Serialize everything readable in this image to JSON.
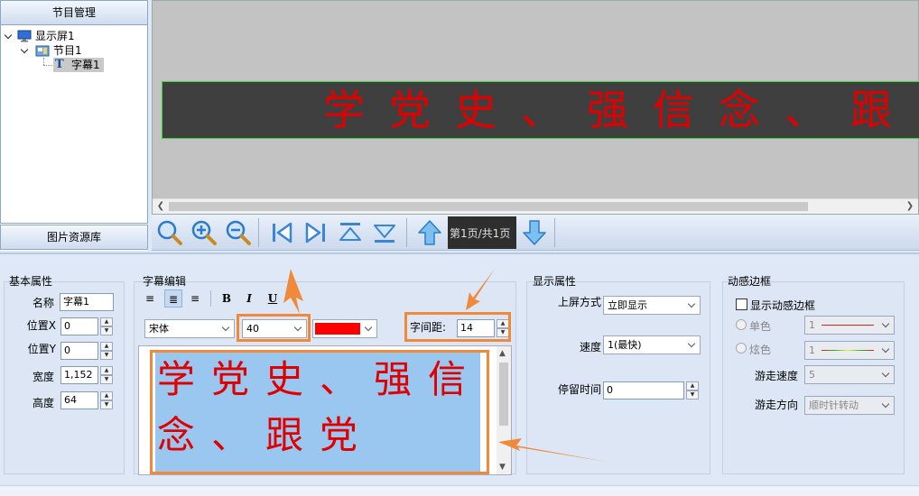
{
  "left_panel": {
    "header": "节目管理",
    "footer": "图片资源库",
    "tree": [
      {
        "label": "显示屏1"
      },
      {
        "label": "节目1"
      },
      {
        "label": "字幕1"
      }
    ]
  },
  "preview": {
    "led_text": "学党史、强信念、跟党"
  },
  "toolbar": {
    "page_indicator": "第1页/共1页",
    "buttons": [
      "zoom-fit",
      "zoom-in",
      "zoom-out",
      "first",
      "last",
      "move-top",
      "move-bottom",
      "move-up",
      "move-down"
    ]
  },
  "basic": {
    "title": "基本属性",
    "name_label": "名称",
    "name_value": "字幕1",
    "posx_label": "位置X",
    "posx_value": "0",
    "posy_label": "位置Y",
    "posy_value": "0",
    "width_label": "宽度",
    "width_value": "1,152",
    "height_label": "高度",
    "height_value": "64"
  },
  "subtitle_edit": {
    "title": "字幕编辑",
    "bold": "B",
    "italic": "I",
    "underline": "U",
    "font": "宋体",
    "font_size": "40",
    "color": "#ff0000",
    "spacing_label": "字间距:",
    "spacing_value": "14",
    "text": "学党史、强信念、跟党"
  },
  "display": {
    "title": "显示属性",
    "mode_label": "上屏方式",
    "mode_value": "立即显示",
    "speed_label": "速度",
    "speed_value": "1(最快)",
    "stay_label": "停留时间",
    "stay_value": "0"
  },
  "border": {
    "title": "动感边框",
    "show_label": "显示动感边框",
    "mono_label": "单色",
    "mono_value": "1",
    "multi_label": "炫色",
    "multi_value": "1",
    "speed_label": "游走速度",
    "speed_value": "5",
    "dir_label": "游走方向",
    "dir_value": "顺时针转动"
  },
  "colors": {
    "led_text": "#e00000",
    "highlight": "#f08a3a"
  }
}
